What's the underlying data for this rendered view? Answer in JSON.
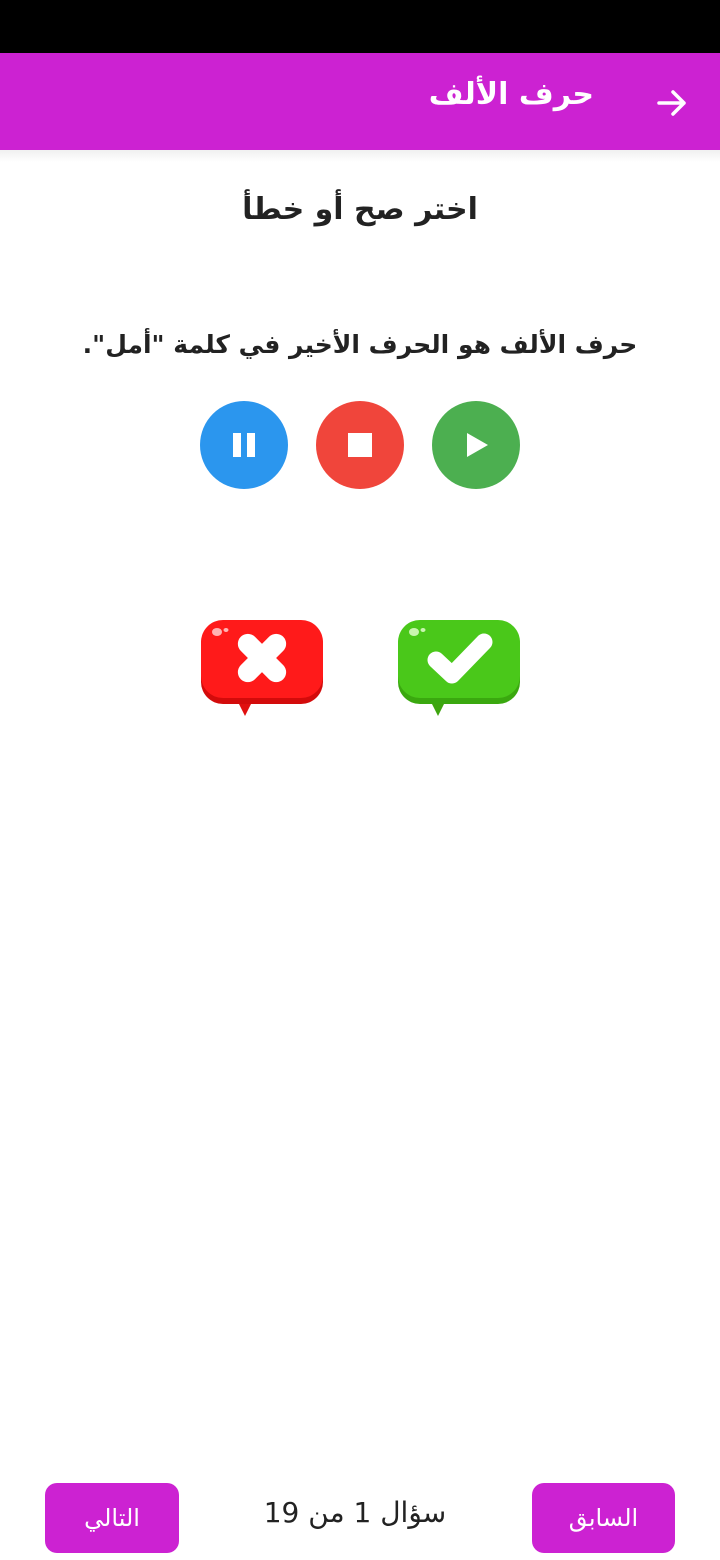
{
  "app_bar": {
    "title": "حرف الألف",
    "back_icon": "arrow-right-icon",
    "color": "#cc22d2"
  },
  "page": {
    "title": "اختر صح أو خطأ",
    "question": "حرف الألف هو الحرف الأخير في كلمة \"أمل\"."
  },
  "media_controls": [
    {
      "icon": "pause-icon",
      "color": "#2b96ee"
    },
    {
      "icon": "stop-icon",
      "color": "#f0453b"
    },
    {
      "icon": "play-icon",
      "color": "#4caf50"
    }
  ],
  "answers": [
    {
      "icon": "wrong-x-icon",
      "color": "#ff1a1a"
    },
    {
      "icon": "correct-check-icon",
      "color": "#4ac81a"
    }
  ],
  "footer": {
    "next_label": "التالي",
    "counter": "سؤال 1 من 19",
    "prev_label": "السابق"
  }
}
